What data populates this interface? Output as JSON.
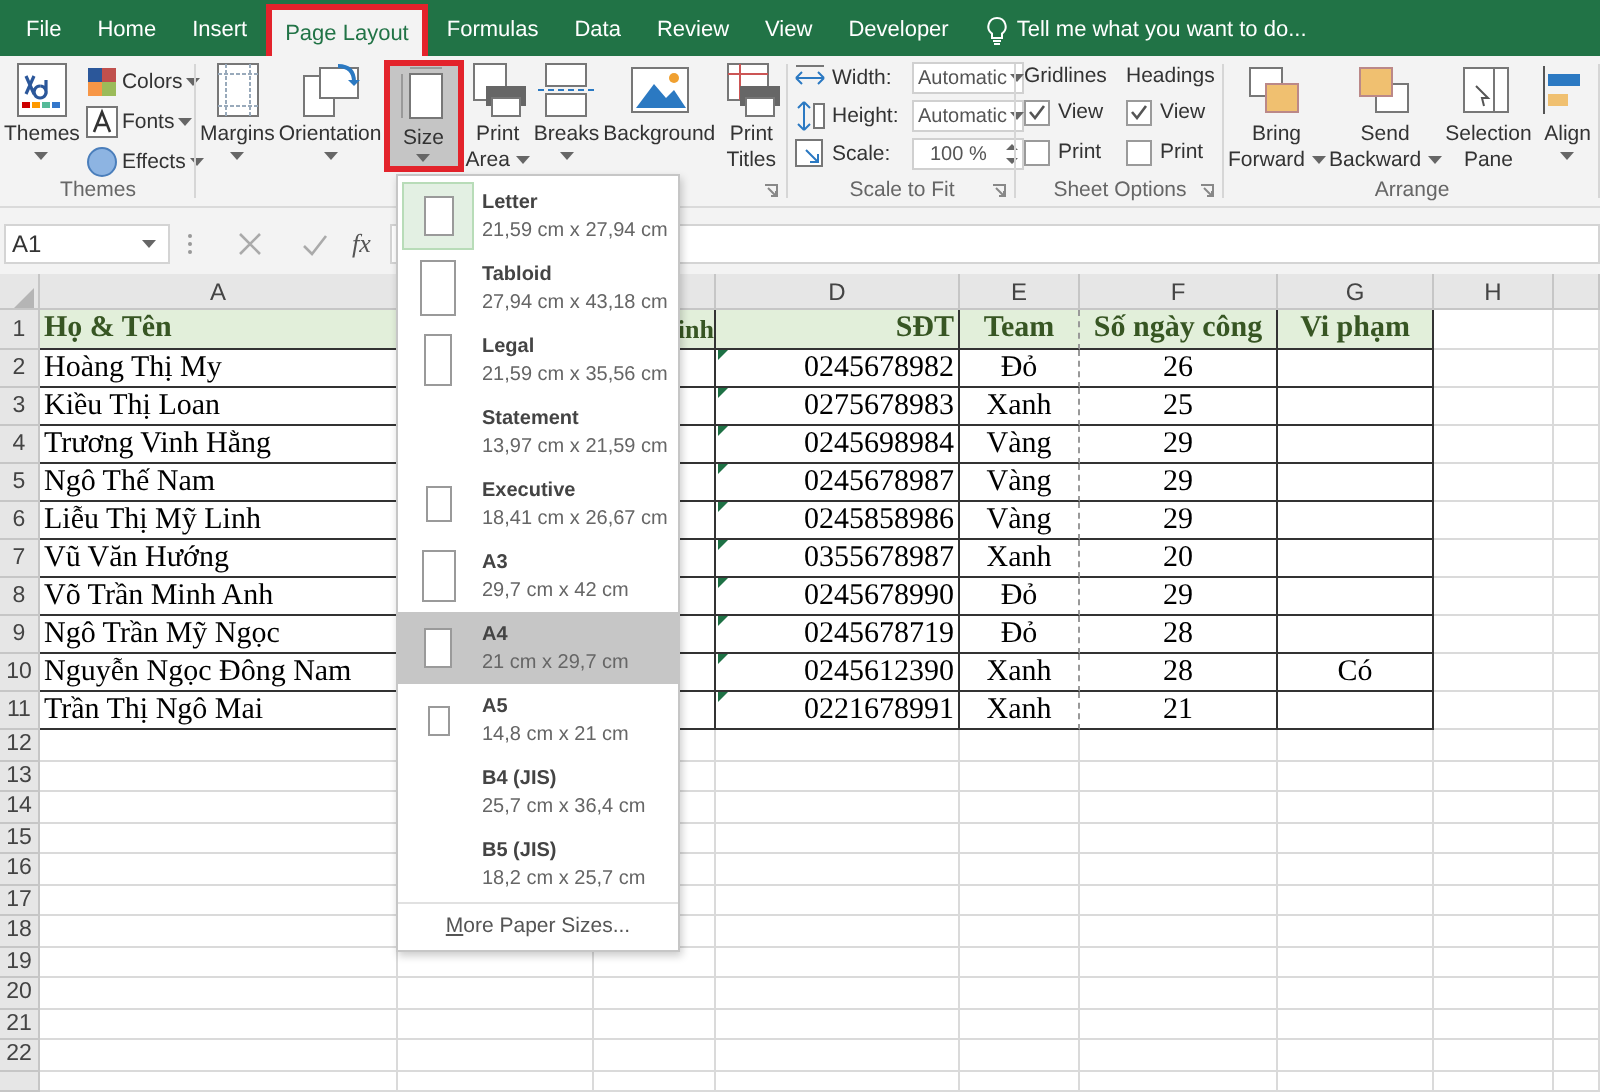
{
  "tabs": [
    {
      "label": "File",
      "selected": false
    },
    {
      "label": "Home",
      "selected": false
    },
    {
      "label": "Insert",
      "selected": false
    },
    {
      "label": "Page Layout",
      "selected": true
    },
    {
      "label": "Formulas",
      "selected": false
    },
    {
      "label": "Data",
      "selected": false
    },
    {
      "label": "Review",
      "selected": false
    },
    {
      "label": "View",
      "selected": false
    },
    {
      "label": "Developer",
      "selected": false
    }
  ],
  "tell_me": {
    "placeholder": "Tell me what you want to do..."
  },
  "ribbon": [
    {
      "label": "Themes",
      "launcher": false,
      "controls": [
        {
          "kind": "large",
          "lines": [
            "Themes"
          ],
          "dropdown": true,
          "pressed": false
        },
        {
          "kind": "stack",
          "items": [
            {
              "label": "Colors",
              "dropdown": true
            },
            {
              "label": "Fonts",
              "dropdown": true
            },
            {
              "label": "Effects",
              "dropdown": true
            }
          ]
        }
      ]
    },
    {
      "launcher": true,
      "controls": [
        {
          "kind": "large",
          "lines": [
            "Margins"
          ],
          "dropdown": true,
          "pressed": false
        },
        {
          "kind": "large",
          "lines": [
            "Orientation"
          ],
          "dropdown": true,
          "pressed": false
        },
        {
          "kind": "large",
          "lines": [
            "Size"
          ],
          "dropdown": true,
          "pressed": true
        },
        {
          "kind": "large",
          "lines": [
            "Print",
            "Area"
          ],
          "dropdown": true,
          "pressed": false
        },
        {
          "kind": "large",
          "lines": [
            "Breaks"
          ],
          "dropdown": true,
          "pressed": false
        },
        {
          "kind": "large",
          "lines": [
            "Background"
          ],
          "dropdown": false,
          "pressed": false
        },
        {
          "kind": "large",
          "lines": [
            "Print",
            "Titles"
          ],
          "dropdown": false,
          "pressed": false
        }
      ]
    },
    {
      "label": "Scale to Fit",
      "launcher": true,
      "controls": [
        {
          "kind": "fields",
          "items": [
            {
              "label": "Width:",
              "value": "Automatic",
              "kind": "select"
            },
            {
              "label": "Height:",
              "value": "Automatic",
              "kind": "select"
            },
            {
              "label": "Scale:",
              "value": "100 %",
              "kind": "spin"
            }
          ]
        }
      ]
    },
    {
      "label": "Sheet Options",
      "launcher": true,
      "controls": [
        {
          "kind": "checks",
          "heading": "Gridlines",
          "items": [
            {
              "label": "View",
              "checked": true
            },
            {
              "label": "Print",
              "checked": false
            }
          ]
        },
        {
          "kind": "checks",
          "heading": "Headings",
          "items": [
            {
              "label": "View",
              "checked": true
            },
            {
              "label": "Print",
              "checked": false
            }
          ]
        }
      ]
    },
    {
      "label": "Arrange",
      "launcher": false,
      "controls": [
        {
          "kind": "large",
          "lines": [
            "Bring",
            "Forward"
          ],
          "dropdown": true,
          "pressed": false
        },
        {
          "kind": "large",
          "lines": [
            "Send",
            "Backward"
          ],
          "dropdown": true,
          "pressed": false
        },
        {
          "kind": "large",
          "lines": [
            "Selection",
            "Pane"
          ],
          "dropdown": false,
          "pressed": false
        },
        {
          "kind": "large",
          "lines": [
            "Align"
          ],
          "dropdown": true,
          "pressed": false
        }
      ]
    }
  ],
  "formula_bar": {
    "name_box": "A1",
    "function_label": "fx"
  },
  "sheet": {
    "columns": [
      {
        "letter": "A"
      },
      {},
      {},
      {
        "letter": "D"
      },
      {
        "letter": "E"
      },
      {
        "letter": "F"
      },
      {
        "letter": "G"
      },
      {
        "letter": "H"
      }
    ],
    "rows": [
      {
        "number": "1",
        "header": true,
        "cells": {
          "A": "Họ & Tên",
          "C": "inh",
          "D": "SĐT",
          "E": "Team",
          "F": "Số ngày công",
          "G": "Vi phạm"
        }
      },
      {
        "number": "2",
        "flagged": true,
        "cells": {
          "A": "Hoàng Thị My",
          "D": "0245678982",
          "E": "Đỏ",
          "F": "26"
        }
      },
      {
        "number": "3",
        "flagged": true,
        "cells": {
          "A": "Kiều Thị Loan",
          "D": "0275678983",
          "E": "Xanh",
          "F": "25"
        }
      },
      {
        "number": "4",
        "flagged": true,
        "cells": {
          "A": "Trương Vinh Hằng",
          "D": "0245698984",
          "E": "Vàng",
          "F": "29"
        }
      },
      {
        "number": "5",
        "flagged": true,
        "cells": {
          "A": "Ngô Thế Nam",
          "D": "0245678987",
          "E": "Vàng",
          "F": "29"
        }
      },
      {
        "number": "6",
        "flagged": true,
        "cells": {
          "A": "Liễu Thị Mỹ Linh",
          "D": "0245858986",
          "E": "Vàng",
          "F": "29"
        }
      },
      {
        "number": "7",
        "flagged": true,
        "cells": {
          "A": "Vũ Văn Hướng",
          "D": "0355678987",
          "E": "Xanh",
          "F": "20"
        }
      },
      {
        "number": "8",
        "flagged": true,
        "cells": {
          "A": "Võ Trần Minh Anh",
          "D": "0245678990",
          "E": "Đỏ",
          "F": "29"
        }
      },
      {
        "number": "9",
        "flagged": true,
        "cells": {
          "A": "Ngô Trần Mỹ Ngọc",
          "D": "0245678719",
          "E": "Đỏ",
          "F": "28"
        }
      },
      {
        "number": "10",
        "flagged": true,
        "cells": {
          "A": "Nguyễn Ngọc Đông Nam",
          "D": "0245612390",
          "E": "Xanh",
          "F": "28",
          "G": "Có"
        }
      },
      {
        "number": "11",
        "flagged": true,
        "cells": {
          "A": "Trần Thị Ngô Mai",
          "D": "0221678991",
          "E": "Xanh",
          "F": "21"
        }
      },
      {
        "number": "12"
      },
      {
        "number": "13"
      },
      {
        "number": "14"
      },
      {
        "number": "15"
      },
      {
        "number": "16"
      },
      {
        "number": "17"
      },
      {
        "number": "18"
      },
      {
        "number": "19"
      },
      {
        "number": "20"
      },
      {
        "number": "21"
      },
      {
        "number": "22"
      }
    ]
  },
  "size_menu": {
    "items": [
      {
        "name": "Letter",
        "dims": "21,59 cm x 27,94 cm",
        "current": true,
        "selected": false
      },
      {
        "name": "Tabloid",
        "dims": "27,94 cm x 43,18 cm",
        "current": false,
        "selected": false
      },
      {
        "name": "Legal",
        "dims": "21,59 cm x 35,56 cm",
        "current": false,
        "selected": false
      },
      {
        "name": "Statement",
        "dims": "13,97 cm x 21,59 cm",
        "current": false,
        "selected": false
      },
      {
        "name": "Executive",
        "dims": "18,41 cm x 26,67 cm",
        "current": false,
        "selected": false
      },
      {
        "name": "A3",
        "dims": "29,7 cm x 42 cm",
        "current": false,
        "selected": false
      },
      {
        "name": "A4",
        "dims": "21 cm x 29,7 cm",
        "current": false,
        "selected": true
      },
      {
        "name": "A5",
        "dims": "14,8 cm x 21 cm",
        "current": false,
        "selected": false
      },
      {
        "name": "B4 (JIS)",
        "dims": "25,7 cm x 36,4 cm",
        "current": false,
        "selected": false
      },
      {
        "name": "B5 (JIS)",
        "dims": "18,2 cm x 25,7 cm",
        "current": false,
        "selected": false
      }
    ],
    "more": "More Paper Sizes..."
  }
}
